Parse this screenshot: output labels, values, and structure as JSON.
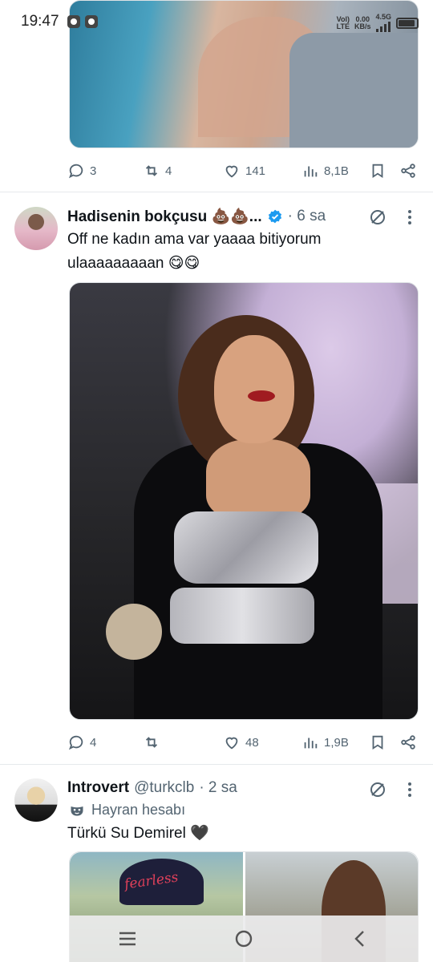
{
  "status_bar": {
    "time": "19:47",
    "net_type_top": "Vol)",
    "net_type_bottom": "LTE",
    "speed_value": "0.00",
    "speed_unit": "KB/s",
    "signal_label": "4.5G"
  },
  "tweets": [
    {
      "actions": {
        "replies": "3",
        "retweets": "4",
        "likes": "141",
        "views": "8,1B"
      }
    },
    {
      "author_name": "Hadisenin bokçusu 💩💩...",
      "time": "· 6 sa",
      "verified": true,
      "text_line1": "Off ne kadın ama var yaaaa bitiyorum",
      "text_line2": "ulaaaaaaaaan 😋😋",
      "actions": {
        "replies": "4",
        "retweets": "",
        "likes": "48",
        "views": "1,9B"
      }
    },
    {
      "author_name": "Introvert",
      "handle": "@turkclb",
      "time": "· 2 sa",
      "sub_label": "Hayran hesabı",
      "text": "Türkü Su Demirel 🖤",
      "media_text": "fearless"
    }
  ],
  "icons": {
    "reply": "reply-icon",
    "retweet": "retweet-icon",
    "like": "heart-icon",
    "views": "views-icon",
    "bookmark": "bookmark-icon",
    "share": "share-icon",
    "grok": "grok-icon",
    "more": "more-icon",
    "verified": "verified-badge-icon",
    "mask": "mask-icon"
  },
  "colors": {
    "accent": "#1d9bf0",
    "muted": "#536471",
    "text": "#0f1419"
  }
}
